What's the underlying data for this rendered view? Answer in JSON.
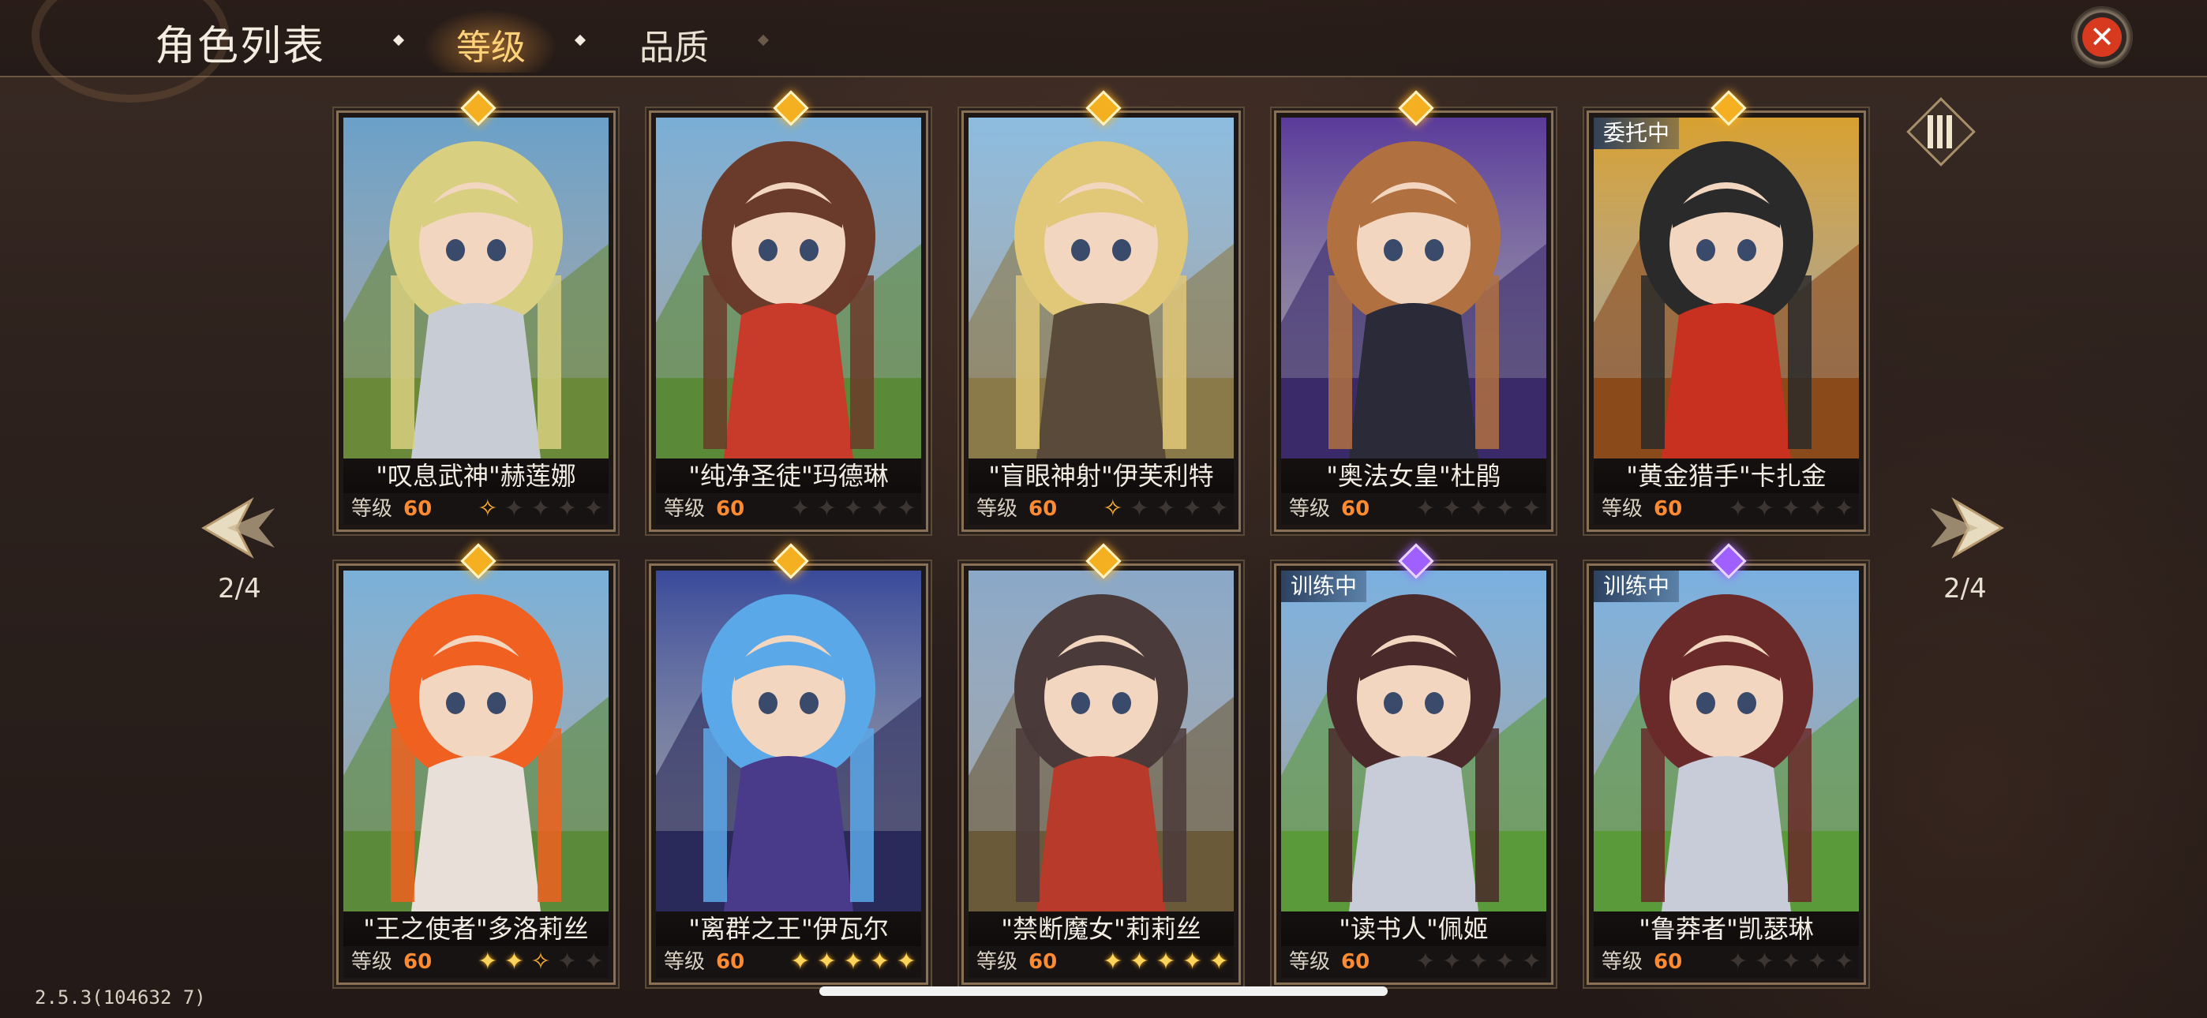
{
  "header": {
    "title": "角色列表",
    "tabs": [
      {
        "label": "等级",
        "active": true
      },
      {
        "label": "品质",
        "active": false
      }
    ],
    "close_icon": "close-x-icon"
  },
  "pager": {
    "left_indicator": "2/4",
    "right_indicator": "2/4"
  },
  "filter_icon": "filter-columns-icon",
  "level_label": "等级",
  "cards": [
    {
      "name": "\"叹息武神\"赫莲娜",
      "level": "60",
      "stars": [
        "half",
        "empty",
        "empty",
        "empty",
        "empty"
      ],
      "gem": "gold",
      "status": "",
      "palette": {
        "bg": "#6aa0c8",
        "ground": "#6a8a3a",
        "hair": "#d8d080",
        "outfit": "#c8ccd4"
      }
    },
    {
      "name": "\"纯净圣徒\"玛德琳",
      "level": "60",
      "stars": [
        "empty",
        "empty",
        "empty",
        "empty",
        "empty"
      ],
      "gem": "gold",
      "status": "",
      "palette": {
        "bg": "#7aaed6",
        "ground": "#5a8a38",
        "hair": "#6a3a2a",
        "outfit": "#c83a2a"
      }
    },
    {
      "name": "\"盲眼神射\"伊芙利特",
      "level": "60",
      "stars": [
        "half",
        "empty",
        "empty",
        "empty",
        "empty"
      ],
      "gem": "gold",
      "status": "",
      "palette": {
        "bg": "#8cbce0",
        "ground": "#8a7a4a",
        "hair": "#e0c878",
        "outfit": "#5a4a3a"
      }
    },
    {
      "name": "\"奥法女皇\"杜鹃",
      "level": "60",
      "stars": [
        "empty",
        "empty",
        "empty",
        "empty",
        "empty"
      ],
      "gem": "gold",
      "status": "",
      "palette": {
        "bg": "#5a3a9a",
        "ground": "#3a2a6a",
        "hair": "#b07040",
        "outfit": "#2a2a38"
      }
    },
    {
      "name": "\"黄金猎手\"卡扎金",
      "level": "60",
      "stars": [
        "empty",
        "empty",
        "empty",
        "empty",
        "empty"
      ],
      "gem": "gold",
      "status": "委托中",
      "palette": {
        "bg": "#d8a030",
        "ground": "#8a4a1a",
        "hair": "#2a2a2a",
        "outfit": "#c83020"
      }
    },
    {
      "name": "\"王之使者\"多洛莉丝",
      "level": "60",
      "stars": [
        "full",
        "full",
        "half",
        "empty",
        "empty"
      ],
      "gem": "gold",
      "status": "",
      "palette": {
        "bg": "#7ab0d8",
        "ground": "#5a8a3a",
        "hair": "#f06020",
        "outfit": "#e8e0d8"
      }
    },
    {
      "name": "\"离群之王\"伊瓦尔",
      "level": "60",
      "stars": [
        "full",
        "full",
        "full",
        "full",
        "full"
      ],
      "gem": "gold",
      "status": "",
      "palette": {
        "bg": "#3a4a9a",
        "ground": "#2a2a5a",
        "hair": "#5aa8e8",
        "outfit": "#4a3a8a"
      }
    },
    {
      "name": "\"禁断魔女\"莉莉丝",
      "level": "60",
      "stars": [
        "full",
        "full",
        "full",
        "full",
        "full"
      ],
      "gem": "gold",
      "status": "",
      "palette": {
        "bg": "#8aa8c8",
        "ground": "#6a5a3a",
        "hair": "#4a3a3a",
        "outfit": "#b83a2a"
      }
    },
    {
      "name": "\"读书人\"佩姬",
      "level": "60",
      "stars": [
        "empty",
        "empty",
        "empty",
        "empty",
        "empty"
      ],
      "gem": "purple",
      "status": "训练中",
      "palette": {
        "bg": "#7ab0e0",
        "ground": "#5a9a3a",
        "hair": "#4a2a2a",
        "outfit": "#c8ccd8"
      }
    },
    {
      "name": "\"鲁莽者\"凯瑟琳",
      "level": "60",
      "stars": [
        "empty",
        "empty",
        "empty",
        "empty",
        "empty"
      ],
      "gem": "purple",
      "status": "训练中",
      "palette": {
        "bg": "#7ab0e0",
        "ground": "#5a9a3a",
        "hair": "#6a2a2a",
        "outfit": "#c8ccd8"
      }
    }
  ],
  "version": "2.5.3(104632 7)"
}
